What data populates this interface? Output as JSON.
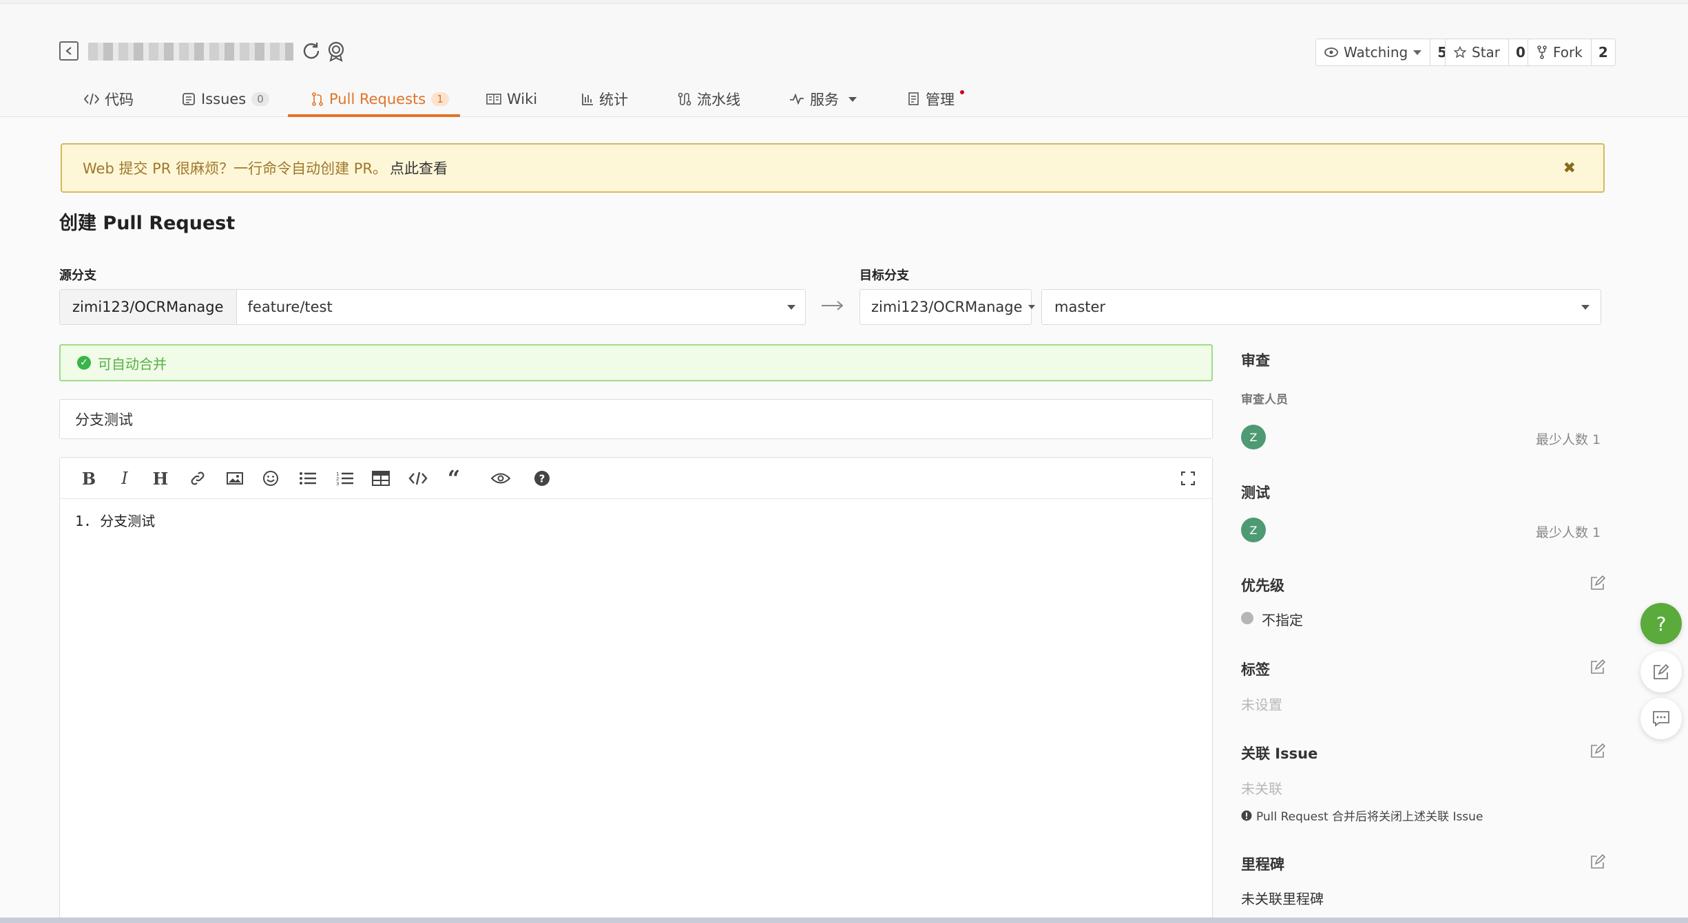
{
  "header": {
    "stats": [
      {
        "label": "Watching",
        "count": "5"
      },
      {
        "label": "Star",
        "count": "0"
      },
      {
        "label": "Fork",
        "count": "2"
      }
    ],
    "tabs": [
      {
        "label": "代码"
      },
      {
        "label": "Issues",
        "badge": "0"
      },
      {
        "label": "Pull Requests",
        "badge": "1"
      },
      {
        "label": "Wiki"
      },
      {
        "label": "统计"
      },
      {
        "label": "流水线"
      },
      {
        "label": "服务"
      },
      {
        "label": "管理"
      }
    ]
  },
  "notice": {
    "text": "Web 提交 PR 很麻烦？一行命令自动创建 PR。",
    "link": "点此查看",
    "close": "✖"
  },
  "page_title": "创建 Pull Request",
  "source": {
    "label": "源分支",
    "repo": "zimi123/OCRManage",
    "branch": "feature/test"
  },
  "target": {
    "label": "目标分支",
    "repo": "zimi123/OCRManage",
    "branch": "master"
  },
  "merge_status": "可自动合并",
  "pr_title": "分支测试",
  "editor": {
    "toolbar": [
      "bold",
      "italic",
      "heading",
      "link",
      "image",
      "emoji",
      "bullet-list",
      "numbered-list",
      "table",
      "code",
      "quote",
      "preview",
      "help",
      "fullscreen"
    ],
    "content": "1. 分支测试"
  },
  "sidebar": {
    "review": {
      "heading": "审查",
      "sub": "审查人员",
      "avatar": "Z",
      "min": "最少人数 1"
    },
    "test": {
      "heading": "测试",
      "avatar": "Z",
      "min": "最少人数 1"
    },
    "priority": {
      "heading": "优先级",
      "value": "不指定"
    },
    "labels": {
      "heading": "标签",
      "value": "未设置"
    },
    "issue": {
      "heading": "关联 Issue",
      "value": "未关联",
      "note": "Pull Request 合并后将关闭上述关联 Issue"
    },
    "milestone": {
      "heading": "里程碑",
      "value": "未关联里程碑"
    }
  },
  "float": {
    "help": "?"
  }
}
